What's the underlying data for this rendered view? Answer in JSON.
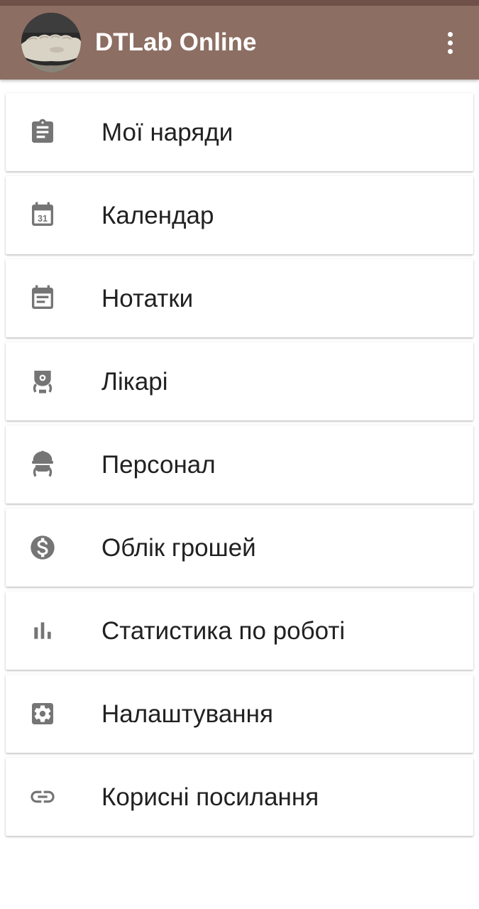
{
  "appbar": {
    "title": "DTLab Online",
    "avatar_icon": "dental-model-avatar",
    "overflow_icon": "more-vert-icon"
  },
  "menu": {
    "items": [
      {
        "label": "Мої наряди",
        "icon": "clipboard-icon"
      },
      {
        "label": "Календар",
        "icon": "calendar-31-icon"
      },
      {
        "label": "Нотатки",
        "icon": "event-note-icon"
      },
      {
        "label": "Лікарі",
        "icon": "doctor-icon"
      },
      {
        "label": "Персонал",
        "icon": "worker-helmet-icon"
      },
      {
        "label": "Облік грошей",
        "icon": "dollar-circle-icon"
      },
      {
        "label": "Статистика по роботі",
        "icon": "bar-chart-icon"
      },
      {
        "label": "Налаштування",
        "icon": "gear-icon"
      },
      {
        "label": "Корисні посилання",
        "icon": "link-icon"
      }
    ]
  },
  "colors": {
    "appbar": "#8d6e63",
    "statusbar": "#6f5149",
    "icon": "#757575",
    "text": "#212121"
  }
}
